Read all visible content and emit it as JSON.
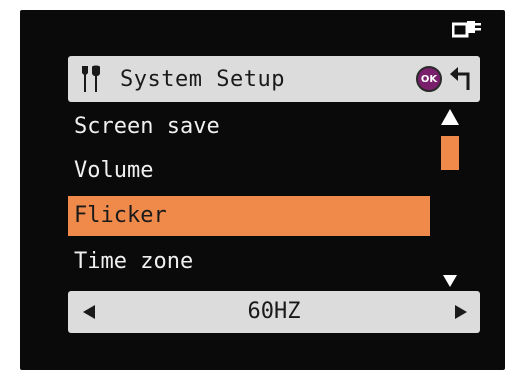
{
  "header": {
    "title": "System Setup",
    "ok_label": "OK"
  },
  "menu": {
    "items": [
      {
        "label": "Screen save",
        "selected": false
      },
      {
        "label": "Volume",
        "selected": false
      },
      {
        "label": "Flicker",
        "selected": true
      },
      {
        "label": "Time zone",
        "selected": false
      }
    ]
  },
  "value_bar": {
    "value": "60HZ"
  },
  "colors": {
    "accent": "#f08a4b",
    "screen": "#0a0a0a",
    "panel": "#dcdcdc",
    "ok_button": "#7a1f6b"
  },
  "icons": [
    "power-plug-icon",
    "tools-icon",
    "ok-button-icon",
    "back-arrow-icon",
    "scroll-up-icon",
    "scroll-down-icon",
    "arrow-left-icon",
    "arrow-right-icon"
  ]
}
